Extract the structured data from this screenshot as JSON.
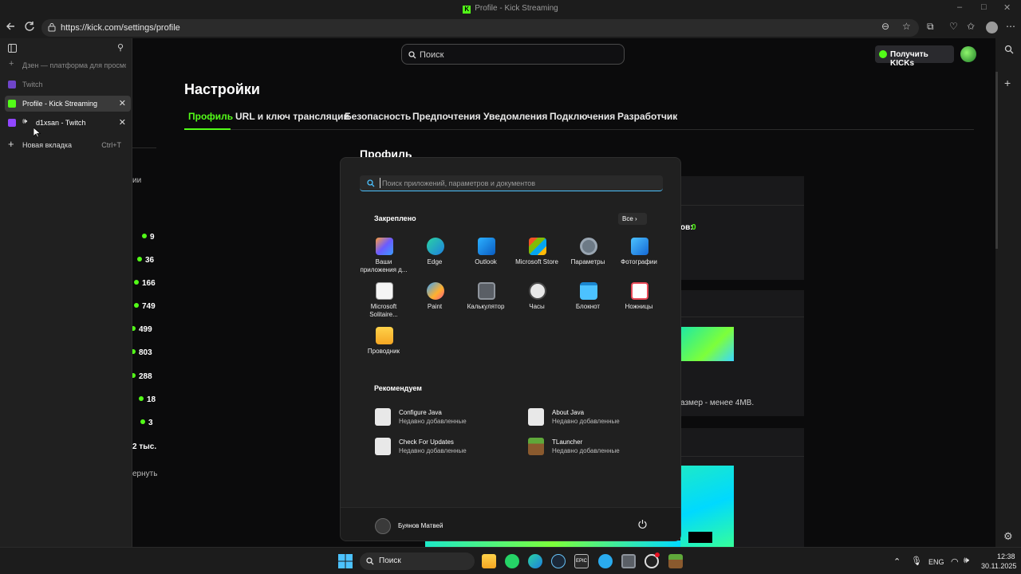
{
  "window": {
    "title": "Profile - Kick Streaming",
    "controls": [
      "–",
      "□",
      "✕"
    ]
  },
  "browser": {
    "url": "https://kick.com/settings/profile",
    "tabs": [
      {
        "label": "Дзен — платформа для просмотра",
        "icon": "add-icon"
      },
      {
        "label": "Twitch",
        "icon": "twitch-icon"
      },
      {
        "label": "Profile - Kick Streaming",
        "icon": "kick-icon",
        "active": true
      },
      {
        "label": "d1xsan - Twitch",
        "icon": "twitch-icon"
      }
    ],
    "new_tab": {
      "label": "Новая вкладка",
      "shortcut": "Ctrl+T"
    }
  },
  "kick": {
    "search_placeholder": "Поиск",
    "get_kicks": "Получить KICKs",
    "settings_title": "Настройки",
    "tabs": [
      "Профиль",
      "URL и ключ трансляции",
      "Безопасность",
      "Предпочтения",
      "Уведомления",
      "Подключения",
      "Разработчик"
    ],
    "profile_title": "Профиль",
    "followers_fragment": "ов:",
    "followers_value": "0",
    "size_hint": "азмер - менее 4MB.",
    "left_fragment": "ии",
    "left_counts": [
      "9",
      "36",
      "166",
      "749",
      "499",
      "803",
      "288",
      "18",
      "3"
    ],
    "left_more": "2 тыс.",
    "left_return": "ернуть",
    "accent": "#53fc18"
  },
  "start_menu": {
    "search_placeholder": "Поиск приложений, параметров и документов",
    "pinned_label": "Закреплено",
    "all_label": "Все  ›",
    "pinned": [
      {
        "label": "Ваши приложения д...",
        "icon": "apps-icon"
      },
      {
        "label": "Edge",
        "icon": "edge-icon"
      },
      {
        "label": "Outlook",
        "icon": "outlook-icon"
      },
      {
        "label": "Microsoft Store",
        "icon": "store-icon"
      },
      {
        "label": "Параметры",
        "icon": "settings-icon"
      },
      {
        "label": "Фотографии",
        "icon": "photos-icon"
      },
      {
        "label": "Microsoft Solitaire...",
        "icon": "solitaire-icon"
      },
      {
        "label": "Paint",
        "icon": "paint-icon"
      },
      {
        "label": "Калькулятор",
        "icon": "calculator-icon"
      },
      {
        "label": "Часы",
        "icon": "clock-icon"
      },
      {
        "label": "Блокнот",
        "icon": "notepad-icon"
      },
      {
        "label": "Ножницы",
        "icon": "snipping-icon"
      },
      {
        "label": "Проводник",
        "icon": "explorer-icon"
      }
    ],
    "recommended_label": "Рекомендуем",
    "recommended": [
      {
        "title": "Configure Java",
        "subtitle": "Недавно добавленные"
      },
      {
        "title": "About Java",
        "subtitle": "Недавно добавленные"
      },
      {
        "title": "Check For Updates",
        "subtitle": "Недавно добавленные"
      },
      {
        "title": "TLauncher",
        "subtitle": "Недавно добавленные"
      }
    ],
    "user": "Буянов Матвей"
  },
  "taskbar": {
    "search": "Поиск",
    "lang": "ENG",
    "time": "12:38",
    "date": "30.11.2025"
  }
}
